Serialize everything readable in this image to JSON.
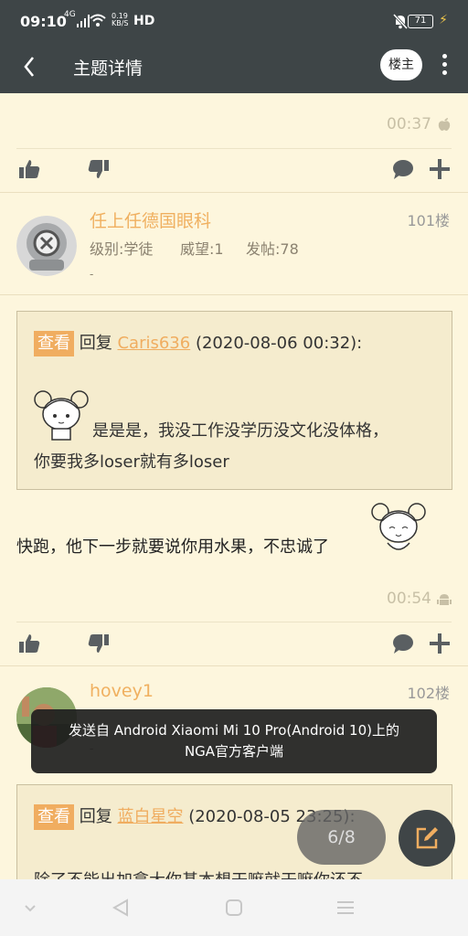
{
  "status": {
    "time": "09:10",
    "network": "4G",
    "speed_value": "0.19",
    "speed_unit": "KB/S",
    "hd": "HD",
    "battery": "71"
  },
  "header": {
    "title": "主题详情",
    "louzhu_label": "楼主"
  },
  "posts": [
    {
      "time": "00:37",
      "os": "apple"
    },
    {
      "username": "任上任德国眼科",
      "floor": "101楼",
      "level": "级别:学徒",
      "prestige": "威望:1",
      "posts": "发帖:78",
      "signature": "-",
      "quote": {
        "tag": "查看",
        "reply_prefix": "回复",
        "reply_user": "Caris636",
        "reply_date": "(2020-08-06 00:32):",
        "line1": "是是是，我没工作没学历没文化没体格，",
        "line2": "你要我多loser就有多loser"
      },
      "body": "快跑，他下一步就要说你用水果，不忠诚了",
      "time": "00:54",
      "os": "android"
    },
    {
      "username": "hovey1",
      "floor": "102楼",
      "signature": "-",
      "quote": {
        "tag": "查看",
        "reply_prefix": "回复",
        "reply_user": "蓝白星空",
        "reply_date": "(2020-08-05 23:25):",
        "line1": "除了不能出加拿大你基本想干嘛就干嘛你还不"
      }
    }
  ],
  "toast": {
    "line1": "发送自 Android Xiaomi Mi 10 Pro(Android 10)上的",
    "line2": "NGA官方客户端"
  },
  "pager": "6/8"
}
